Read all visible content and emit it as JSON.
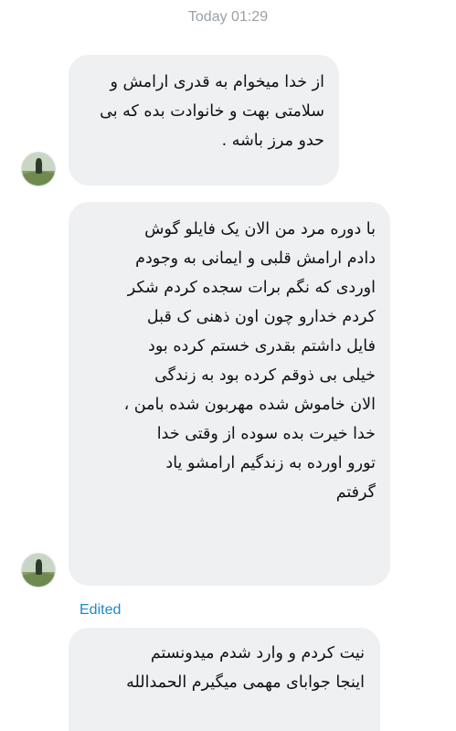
{
  "header": {
    "timestamp": "Today 01:29"
  },
  "messages": [
    {
      "lines": [
        "از خدا میخوام به قدری ارامش و",
        "سلامتی بهت و خانوادت بده که بی",
        "حدو مرز باشه ."
      ],
      "avatar_icon": "user-avatar"
    },
    {
      "lines": [
        "با دوره مرد من الان یک فایلو گوش",
        "دادم ارامش قلبی و ایمانی به وجودم",
        "اوردی که نگم برات سجده کردم شکر",
        "کردم خدارو   چون اون ذهنی ک قبل",
        "فایل داشتم بقدری خستم کرده بود",
        "خیلی بی ذوقم کرده بود به زندگی",
        "الان خاموش شده مهربون شده بامن ،",
        "خدا خیرت بده سوده از وقتی خدا",
        "تورو اورده به زندگیم ارامشو یاد",
        "گرفتم"
      ],
      "avatar_icon": "user-avatar"
    },
    {
      "status": "Edited",
      "lines": [
        "نیت کردم و وارد شدم میدونستم",
        "اینجا جوابای مهمی میگیرم  الحمدالله"
      ]
    }
  ]
}
